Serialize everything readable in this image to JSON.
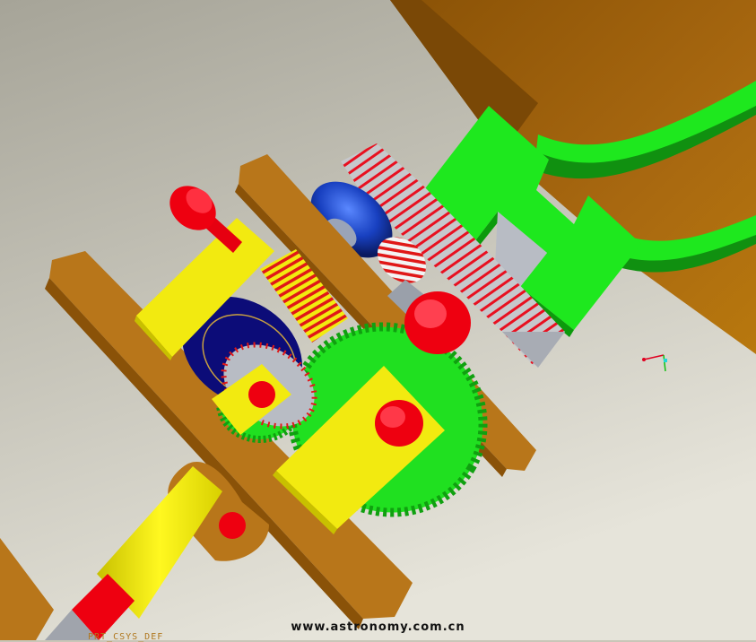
{
  "viewport": {
    "watermark_text": "www.astronomy.com.cn",
    "csys_label": "PRT_CSYS_DEF"
  },
  "colors": {
    "background_top": "#a8a69a",
    "background_bottom": "#e4e2d8",
    "bracket_brown": "#b8761a",
    "bracket_brown_dark": "#8a5208",
    "housing_brown": "#a8680c",
    "bracket_green": "#18e818",
    "gear_green": "#20e020",
    "block_yellow": "#f0ea10",
    "knob_red": "#ee0010",
    "thread_red": "#e81020",
    "gear_grey": "#b8bcc4",
    "disc_navy": "#0c0c78",
    "pulley_blue": "#1840c0",
    "shaft_grey": "#a0a4ac"
  },
  "icons": [
    "triad-axis-icon"
  ]
}
